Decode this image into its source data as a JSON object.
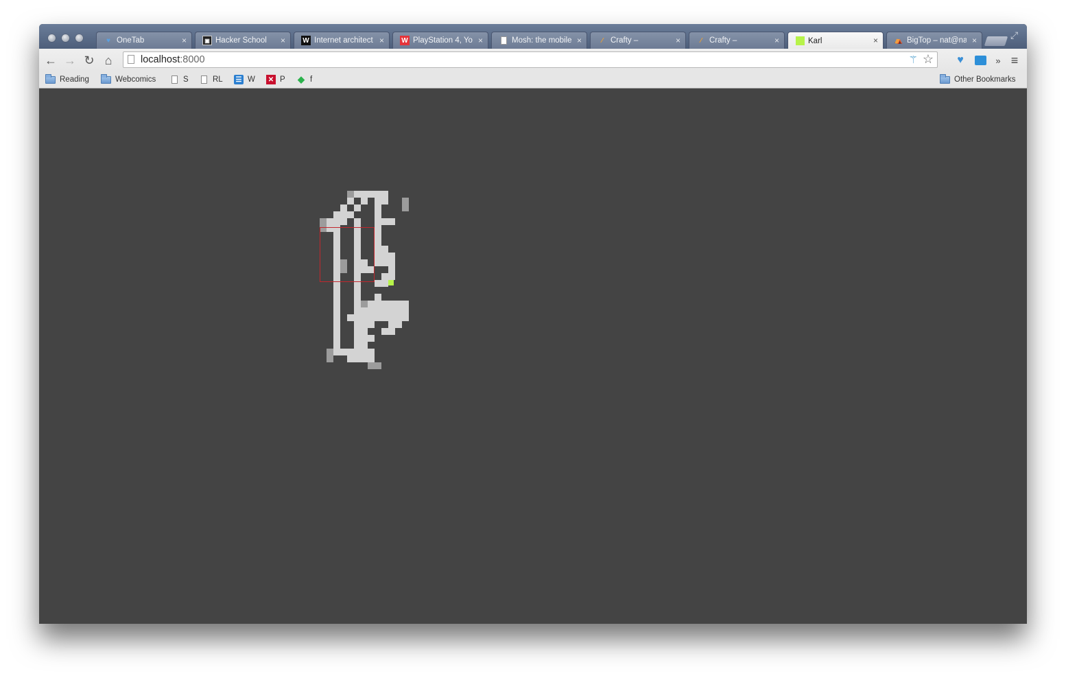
{
  "browser": {
    "tabs": [
      {
        "title": "OneTab",
        "favicon": "onetab-icon",
        "active": false
      },
      {
        "title": "Hacker School",
        "favicon": "hacker-school-icon",
        "active": false
      },
      {
        "title": "Internet architect",
        "favicon": "wikipedia-icon",
        "active": false
      },
      {
        "title": "PlayStation 4, Yo",
        "favicon": "polygon-icon",
        "active": false
      },
      {
        "title": "Mosh: the mobile",
        "favicon": "page-icon",
        "active": false
      },
      {
        "title": "Crafty –",
        "favicon": "crafty-icon",
        "active": false
      },
      {
        "title": "Crafty –",
        "favicon": "crafty-icon",
        "active": false
      },
      {
        "title": "Karl",
        "favicon": "karl-icon",
        "active": true
      },
      {
        "title": "BigTop – nat@na",
        "favicon": "bigtop-icon",
        "active": false
      }
    ],
    "close_glyph": "×",
    "address": {
      "host": "localhost",
      "port": ":8000"
    },
    "bookmarks": [
      {
        "label": "Reading",
        "icon": "folder-icon"
      },
      {
        "label": "Webcomics",
        "icon": "folder-icon"
      },
      {
        "label": "S",
        "icon": "page-icon"
      },
      {
        "label": "RL",
        "icon": "page-icon"
      },
      {
        "label": "W",
        "icon": "w-app-icon"
      },
      {
        "label": "P",
        "icon": "pinboard-icon"
      },
      {
        "label": "f",
        "icon": "feedly-icon"
      }
    ],
    "other_bookmarks": "Other Bookmarks"
  },
  "game": {
    "background": "#444444",
    "floor_color": "#d3d3d3",
    "wall_color": "#9c9c9c",
    "player_color": "#b7f34a",
    "cursor_color": "#c1272d"
  }
}
